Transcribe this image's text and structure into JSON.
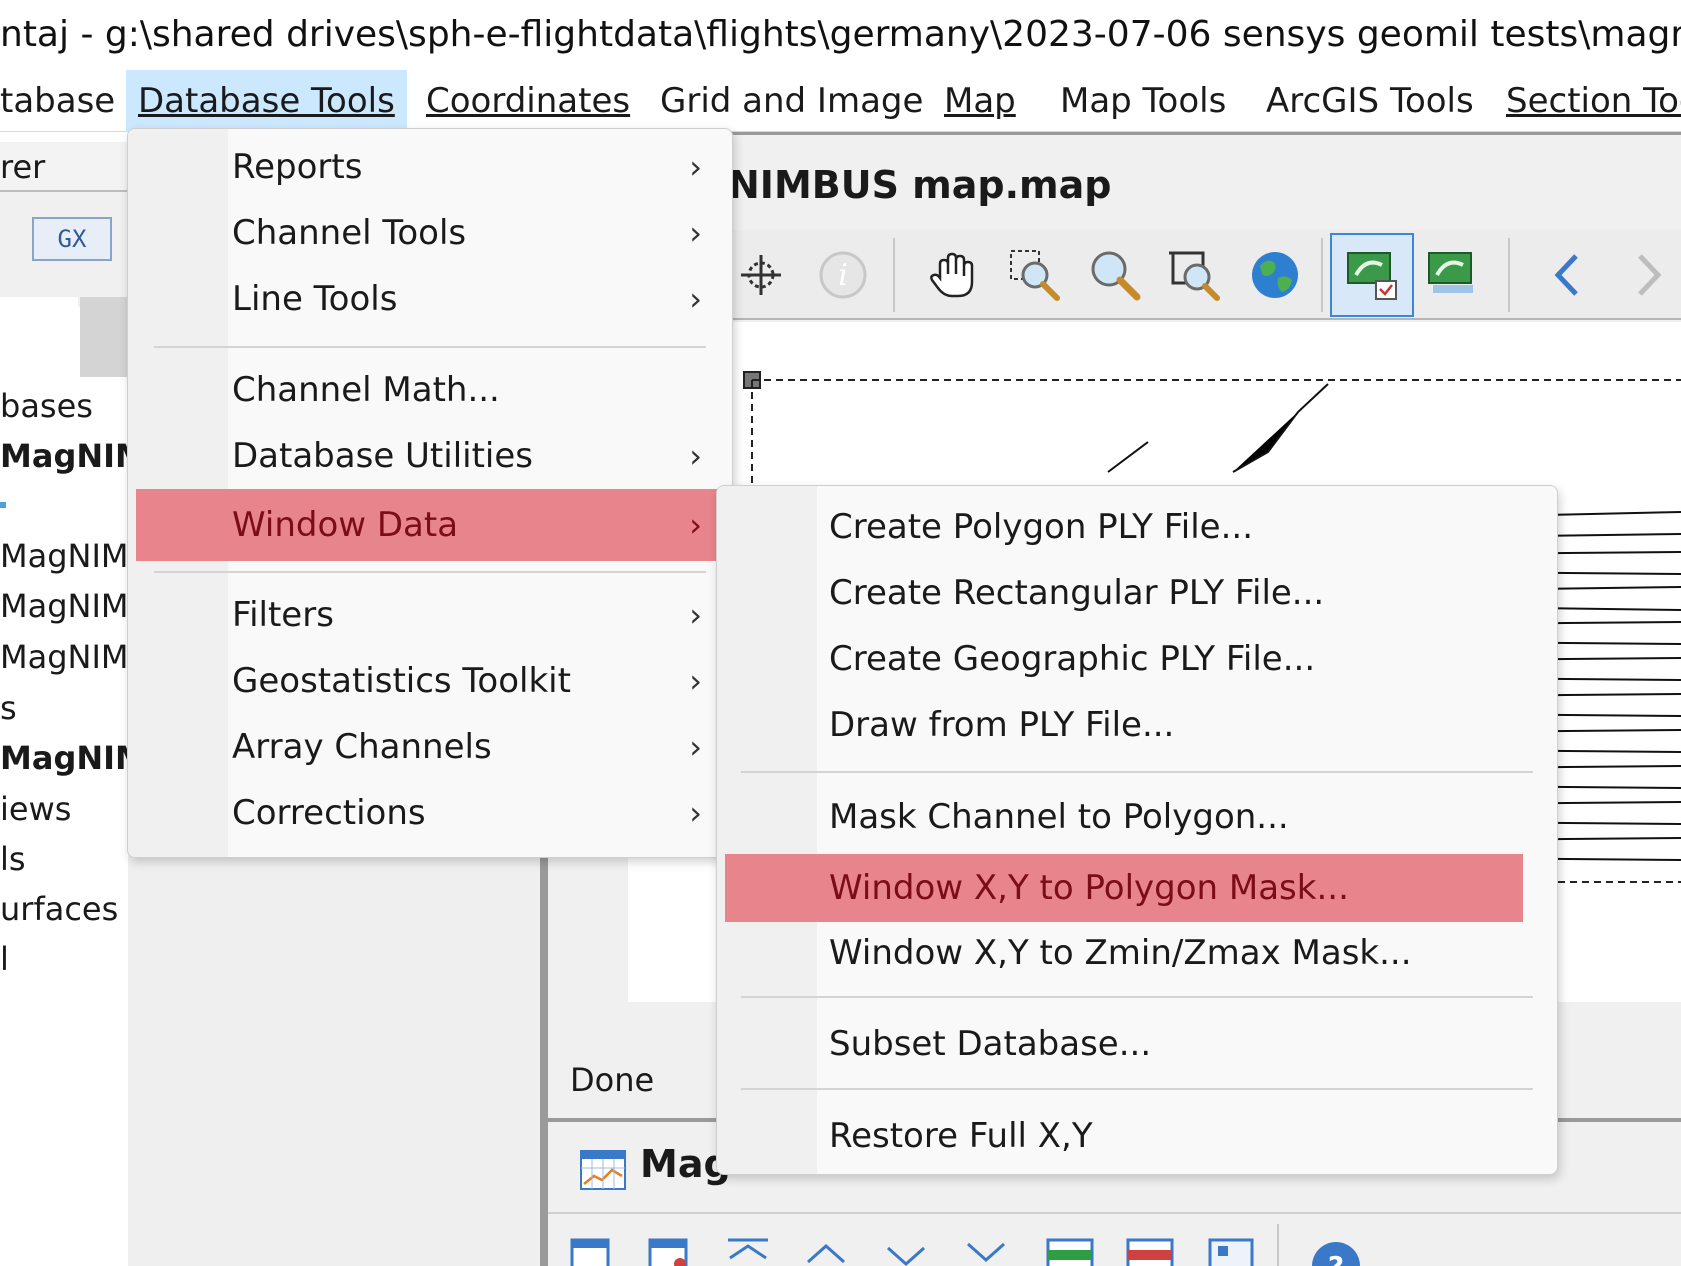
{
  "window": {
    "title": "ntaj - g:\\shared drives\\sph-e-flightdata\\flights\\germany\\2023-07-06 sensys geomil tests\\magnimbus single"
  },
  "menubar": {
    "items": [
      {
        "label": "tabase"
      },
      {
        "label": "Database Tools",
        "active": true
      },
      {
        "label": "Coordinates"
      },
      {
        "label": "Grid and Image"
      },
      {
        "label": "Map"
      },
      {
        "label": "Map Tools"
      },
      {
        "label": "ArcGIS Tools"
      },
      {
        "label": "Section Too"
      }
    ]
  },
  "explorer": {
    "header": "rer",
    "gx_button": "GX",
    "tree": [
      {
        "label": "bases",
        "bold": false
      },
      {
        "label": "MagNIM",
        "bold": true
      },
      {
        "label": "MagNIME",
        "bold": false
      },
      {
        "label": "MagNIME",
        "bold": false
      },
      {
        "label": "MagNIME",
        "bold": false
      },
      {
        "label": "s",
        "bold": false
      },
      {
        "label": "MagNIM",
        "bold": true
      },
      {
        "label": "iews",
        "bold": false
      },
      {
        "label": "ls",
        "bold": false
      },
      {
        "label": "urfaces",
        "bold": false
      },
      {
        "label": "l",
        "bold": false
      }
    ]
  },
  "map_window": {
    "title": "NIMBUS map.map",
    "tools": [
      "crosshair-icon",
      "info-icon",
      "pan-hand-icon",
      "zoom-window-icon",
      "zoom-icon",
      "zoom-extent-icon",
      "globe-icon",
      "map-layer-selected-icon",
      "map-layer-icon",
      "back-arrow-icon",
      "forward-arrow-icon"
    ]
  },
  "status": {
    "text": "Done"
  },
  "db_window": {
    "title": "Mag",
    "tools": [
      "grid-add-icon",
      "grid-edit-icon",
      "first-icon",
      "up-icon",
      "down-icon",
      "last-icon",
      "channel-add-icon",
      "channel-remove-icon",
      "grid-settings-icon",
      "help-icon"
    ]
  },
  "database_tools_menu": {
    "items": [
      {
        "label": "Reports",
        "u": "R",
        "submenu": true
      },
      {
        "label": "Channel Tools",
        "u": "C",
        "submenu": true
      },
      {
        "label": "Line Tools",
        "u": "L",
        "submenu": true
      },
      {
        "label": "Channel Math...",
        "submenu": false
      },
      {
        "label": "Database Utilities",
        "u": "D",
        "submenu": true
      },
      {
        "label": "Window Data",
        "u": "W",
        "submenu": true,
        "highlighted": true
      },
      {
        "label": "Filters",
        "u": "F",
        "submenu": true
      },
      {
        "label": "Geostatistics Toolkit",
        "u": "G",
        "submenu": true
      },
      {
        "label": "Array Channels",
        "u": "A",
        "submenu": true
      },
      {
        "label": "Corrections",
        "u": "C",
        "submenu": true
      }
    ],
    "arrow": "›"
  },
  "window_data_submenu": {
    "items": [
      {
        "label": "Create Polygon PLY File..."
      },
      {
        "label": "Create Rectangular PLY File..."
      },
      {
        "label": "Create Geographic PLY File..."
      },
      {
        "label": "Draw from PLY File..."
      },
      {
        "label": "Mask Channel to Polygon..."
      },
      {
        "label": "Window X,Y to Polygon Mask...",
        "highlighted": true
      },
      {
        "label": "Window X,Y to Zmin/Zmax Mask..."
      },
      {
        "label": "Subset Database..."
      },
      {
        "label": "Restore Full X,Y"
      }
    ]
  },
  "colors": {
    "menu_highlight": "#e8848c",
    "menubar_active": "#cce8ff"
  }
}
